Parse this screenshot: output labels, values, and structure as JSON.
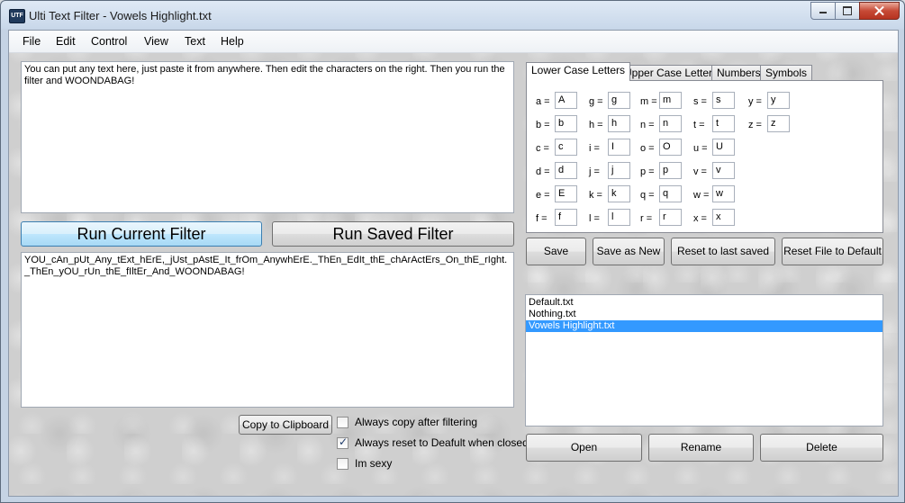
{
  "window": {
    "title": "Ulti Text Filter - Vowels Highlight.txt",
    "icon": "ulti-app-icon",
    "icon_text": "UTF"
  },
  "menu": [
    "File",
    "Edit",
    "Control",
    "View",
    "Text",
    "Help"
  ],
  "input_text": "You can put any text here, just paste it from anywhere. Then edit the characters on the right. Then you run the filter and WOONDABAG!",
  "buttons": {
    "run_current": "Run Current Filter",
    "run_saved": "Run Saved Filter",
    "copy_clipboard": "Copy to Clipboard"
  },
  "output_text": "YOU_cAn_pUt_Any_tExt_hErE,_jUst_pAstE_It_frOm_AnywhErE._ThEn_EdIt_thE_chArActErs_On_thE_rIght._ThEn_yOU_rUn_thE_fIltEr_And_WOONDABAG!",
  "checkboxes": [
    {
      "label": "Always copy after filtering",
      "checked": false
    },
    {
      "label": "Always reset to Deafult when closed",
      "checked": true
    },
    {
      "label": "Im sexy",
      "checked": false
    }
  ],
  "tabs": [
    {
      "label": "Lower Case Letters",
      "active": true
    },
    {
      "label": "Upper Case Letters",
      "active": false
    },
    {
      "label": "Numbers",
      "active": false
    },
    {
      "label": "Symbols",
      "active": false
    }
  ],
  "mappings": [
    [
      "a =",
      "A"
    ],
    [
      "b =",
      "b"
    ],
    [
      "c =",
      "c"
    ],
    [
      "d =",
      "d"
    ],
    [
      "e =",
      "E"
    ],
    [
      "f =",
      "f"
    ],
    [
      "g =",
      "g"
    ],
    [
      "h =",
      "h"
    ],
    [
      "i =",
      "I"
    ],
    [
      "j =",
      "j"
    ],
    [
      "k =",
      "k"
    ],
    [
      "l =",
      "l"
    ],
    [
      "m =",
      "m"
    ],
    [
      "n =",
      "n"
    ],
    [
      "o =",
      "O"
    ],
    [
      "p =",
      "p"
    ],
    [
      "q =",
      "q"
    ],
    [
      "r =",
      "r"
    ],
    [
      "s =",
      "s"
    ],
    [
      "t =",
      "t"
    ],
    [
      "u =",
      "U"
    ],
    [
      "v =",
      "v"
    ],
    [
      "w =",
      "w"
    ],
    [
      "x =",
      "x"
    ],
    [
      "y =",
      "y"
    ],
    [
      "z =",
      "z"
    ]
  ],
  "filter_buttons": {
    "save": "Save",
    "save_as_new": "Save as New",
    "reset_last_saved": "Reset to last saved",
    "reset_default": "Reset File to Default"
  },
  "files": [
    {
      "name": "Default.txt",
      "selected": false
    },
    {
      "name": "Nothing.txt",
      "selected": false
    },
    {
      "name": "Vowels Highlight.txt",
      "selected": true
    }
  ],
  "file_buttons": {
    "open": "Open",
    "rename": "Rename",
    "delete": "Delete"
  }
}
